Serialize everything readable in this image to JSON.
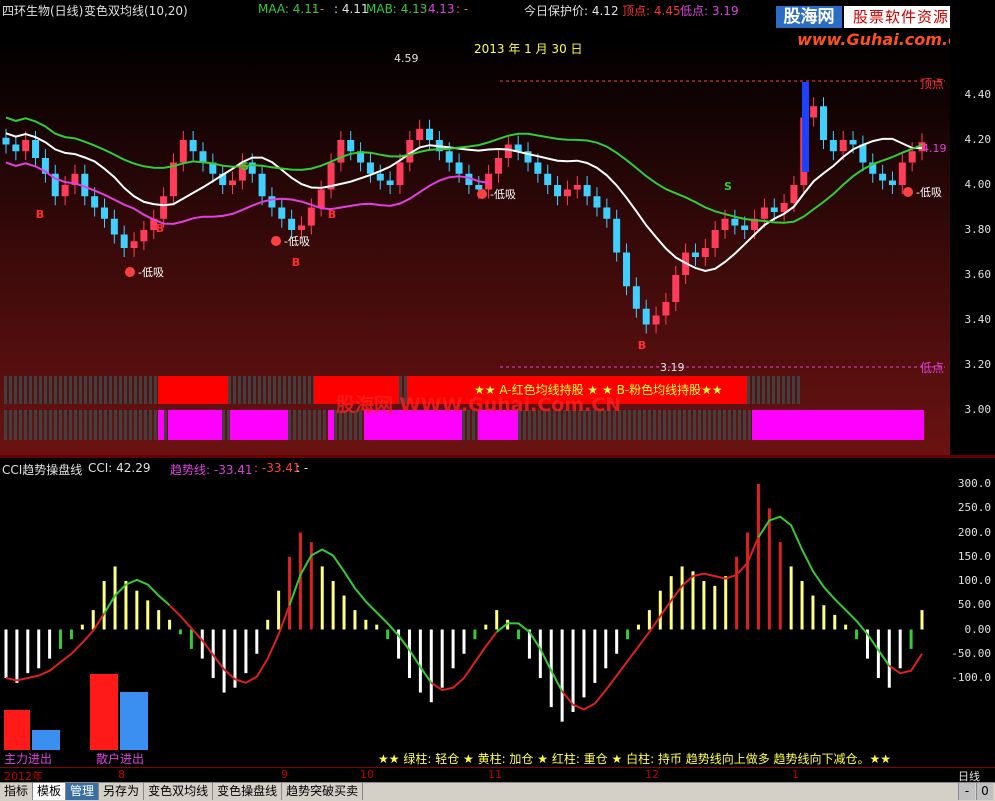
{
  "header": {
    "stock": "四环生物(日线)",
    "indicator": "变色双均线(10,20)",
    "maa_label": "MAA: 4.11",
    "maa_sep": ": -",
    "maa_val2": ": 4.11",
    "mab_label": "MAB: 4.13",
    "mab_val2": ": 4.13",
    "mab_sep": ": -",
    "protect_label": "今日保护价: 4.12",
    "top_label": "顶点: 4.45",
    "bottom_label": "低点: 3.19"
  },
  "logo": {
    "brand": "股海网",
    "tagline": "股票软件资源分享",
    "url": "www.Guhai.com.cn"
  },
  "main_chart": {
    "date_label": "2013 年 1 月 30 日",
    "high_marker": "4.59",
    "low_marker": "3.19",
    "last_price": "4.19",
    "top_line_label": "顶点",
    "bottom_line_label": "低点",
    "signals": {
      "buy": "B",
      "sell": "S",
      "low_absorb": "低吸"
    },
    "strip_text": "★★ A-红色均线持股 ★  ★ B-粉色均线持股★★",
    "watermark": "股海网 WWW.Guhai.Com.CN",
    "y_ticks": [
      "4.40",
      "4.20",
      "4.00",
      "3.80",
      "3.60",
      "3.40",
      "3.20",
      "3.00"
    ]
  },
  "cci_panel": {
    "title": "CCI趋势操盘线",
    "cci_value": "CCI: 42.29",
    "trend_label": "趋势线: -33.41",
    "trend_val2": ": -33.41",
    "trend_sep": ": -",
    "y_ticks": [
      "300.0",
      "250.0",
      "200.0",
      "150.0",
      "100.0",
      "50.00",
      "0.00",
      "-50.00",
      "-100.0"
    ],
    "main_force_label": "主力进出",
    "retail_label": "散户进出",
    "legend": "★★ 绿柱: 轻仓  ★ 黄柱: 加仓  ★ 红柱: 重仓  ★ 白柱: 持币  趋势线向上做多  趋势线向下减仓。★★"
  },
  "date_axis": {
    "labels": [
      "2012年",
      "8",
      "9",
      "10",
      "11",
      "12",
      "1"
    ],
    "period": "日线"
  },
  "tabs": [
    "指标",
    "模板",
    "管理",
    "另存为",
    "变色双均线",
    "变色操盘线",
    "趋势突破买卖"
  ],
  "scroll": {
    "minus": "-",
    "zero": "0"
  },
  "colors": {
    "up": "#ff3c5a",
    "down": "#40d0ff",
    "ma_white": "#ffffff",
    "ma_green": "#33cc33",
    "ma_red": "#ff2020",
    "ma_pink": "#e040e0",
    "strip_red": "#ff0000",
    "strip_pink": "#ff00ff"
  },
  "chart_data": {
    "type": "candlestick",
    "y_range": [
      2.95,
      4.5
    ],
    "candles_close": [
      4.18,
      4.15,
      4.2,
      4.12,
      4.05,
      3.95,
      4.0,
      4.05,
      3.95,
      3.9,
      3.85,
      3.78,
      3.72,
      3.75,
      3.8,
      3.85,
      3.95,
      4.1,
      4.2,
      4.15,
      4.1,
      4.05,
      4.0,
      4.02,
      4.1,
      4.05,
      3.95,
      3.9,
      3.85,
      3.8,
      3.82,
      3.9,
      3.98,
      4.1,
      4.2,
      4.15,
      4.1,
      4.05,
      4.02,
      4.0,
      4.1,
      4.2,
      4.25,
      4.2,
      4.15,
      4.1,
      4.05,
      4.0,
      3.98,
      4.05,
      4.12,
      4.18,
      4.15,
      4.1,
      4.05,
      4.0,
      3.95,
      3.98,
      4.0,
      3.95,
      3.9,
      3.85,
      3.7,
      3.55,
      3.45,
      3.38,
      3.42,
      3.48,
      3.6,
      3.7,
      3.68,
      3.72,
      3.8,
      3.85,
      3.82,
      3.8,
      3.85,
      3.9,
      3.88,
      3.92,
      4.0,
      4.3,
      4.35,
      4.2,
      4.15,
      4.2,
      4.18,
      4.1,
      4.05,
      4.02,
      4.0,
      4.1,
      4.15,
      4.19
    ],
    "cci_bars": [
      -100,
      -110,
      -90,
      -80,
      -60,
      -40,
      -20,
      10,
      40,
      100,
      130,
      100,
      80,
      60,
      40,
      20,
      -10,
      -40,
      -60,
      -100,
      -130,
      -120,
      -90,
      -50,
      20,
      80,
      150,
      200,
      180,
      130,
      100,
      70,
      40,
      20,
      10,
      -20,
      -60,
      -100,
      -130,
      -150,
      -120,
      -80,
      -50,
      -20,
      10,
      40,
      20,
      -20,
      -60,
      -100,
      -160,
      -190,
      -170,
      -140,
      -110,
      -80,
      -50,
      -20,
      10,
      40,
      80,
      110,
      130,
      120,
      100,
      90,
      110,
      150,
      200,
      300,
      250,
      180,
      130,
      100,
      70,
      50,
      30,
      10,
      -20,
      -60,
      -100,
      -120,
      -80,
      -40,
      40
    ]
  }
}
